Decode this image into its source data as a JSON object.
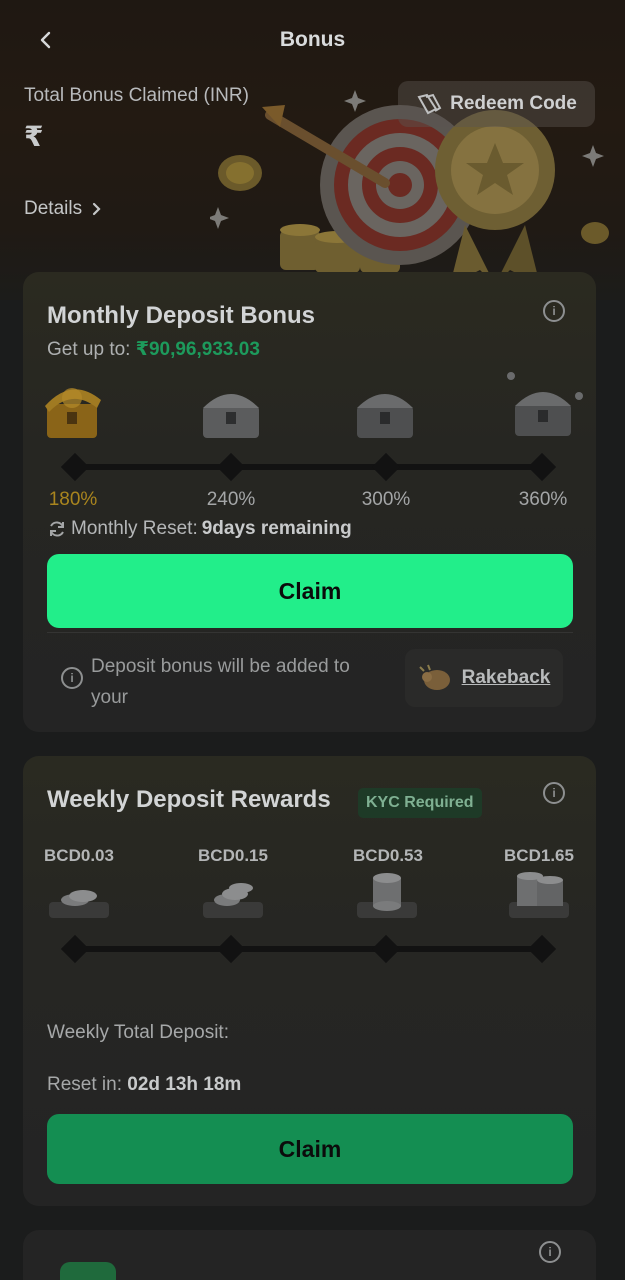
{
  "header": {
    "title": "Bonus",
    "back_icon": "chevron-left-icon"
  },
  "hero": {
    "total_label": "Total Bonus Claimed (INR)",
    "total_value": "₹",
    "details_label": "Details",
    "redeem_label": "Redeem Code"
  },
  "monthly": {
    "title": "Monthly Deposit Bonus",
    "getup_label": "Get up to:",
    "getup_amount": "₹90,96,933.03",
    "tiers": [
      {
        "pct": "180%",
        "active": true
      },
      {
        "pct": "240%",
        "active": false
      },
      {
        "pct": "300%",
        "active": false
      },
      {
        "pct": "360%",
        "active": false
      }
    ],
    "reset_label": "Monthly Reset:",
    "reset_value": "9days remaining",
    "claim_label": "Claim",
    "notice_text": "Deposit bonus will be added to your",
    "rakeback_label": "Rakeback"
  },
  "weekly": {
    "title": "Weekly Deposit Rewards",
    "kyc_label": "KYC Required",
    "tiers": [
      "BCD0.03",
      "BCD0.15",
      "BCD0.53",
      "BCD1.65"
    ],
    "total_label": "Weekly Total Deposit:",
    "reset_label": "Reset in:",
    "reset_value": "02d 13h 18m",
    "claim_label": "Claim"
  },
  "colors": {
    "accent_green": "#22ee8a",
    "dark_green": "#148e52",
    "amount_green": "#1d9a5c",
    "active_gold": "#a9851e"
  }
}
